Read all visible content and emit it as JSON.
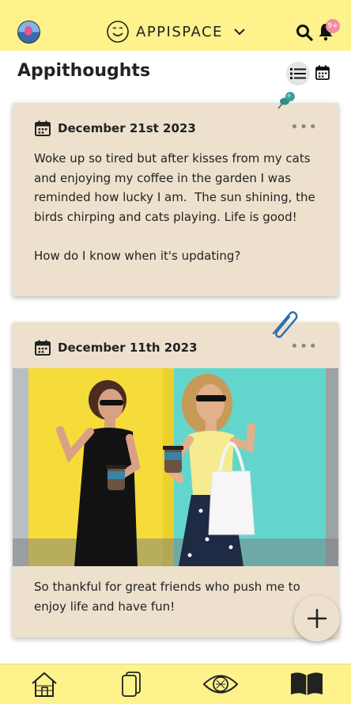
{
  "header": {
    "app_name": "APPISPACE",
    "notification_count": "9+"
  },
  "page": {
    "title": "Appithoughts"
  },
  "entries": [
    {
      "date": "December 21st 2023",
      "text": "Woke up so tired but after kisses from my cats and enjoying my coffee in the garden I was reminded how lucky I am.  The sun shining, the birds chirping and cats playing. Life is good!\n\nHow do I know when it's updating?",
      "attachment_icon": "pushpin-icon"
    },
    {
      "date": "December 11th 2023",
      "text": "So thankful for great friends who push me to enjoy life and have fun!",
      "attachment_icon": "paperclip-icon",
      "has_photo": true
    }
  ],
  "nav": [
    "home-icon",
    "cards-icon",
    "eye-icon",
    "journal-icon"
  ],
  "colors": {
    "bar": "#fdf28c",
    "card": "#ede1cd",
    "pin": "#3a9a94",
    "clip": "#2f6fb1",
    "badge": "#f08fa0"
  }
}
